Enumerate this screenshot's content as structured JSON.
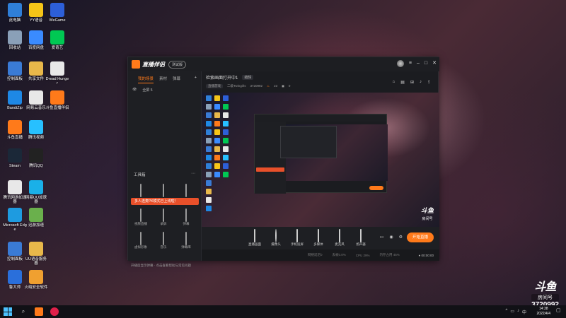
{
  "desktop": {
    "icons": [
      {
        "label": "此电脑",
        "icon": "computer-icon",
        "color": "#2f7fd8"
      },
      {
        "label": "YY语音",
        "icon": "yy-icon",
        "color": "#f5c518"
      },
      {
        "label": "WeGame",
        "icon": "wegame-icon",
        "color": "#2d5fd8"
      },
      {
        "label": "回收站",
        "icon": "recycle-bin-icon",
        "color": "#8aa0b8"
      },
      {
        "label": "百度网盘",
        "icon": "baidu-netdisk-icon",
        "color": "#3a8bff"
      },
      {
        "label": "爱奇艺",
        "icon": "iqiyi-icon",
        "color": "#00c853"
      },
      {
        "label": "控制面板",
        "icon": "control-panel-icon",
        "color": "#3a7bd5"
      },
      {
        "label": "共享文件",
        "icon": "folder-icon",
        "color": "#e8b84a"
      },
      {
        "label": "Dread Hunger",
        "icon": "file-icon",
        "color": "#e8e8e8"
      },
      {
        "label": "BandiZip",
        "icon": "bandizip-icon",
        "color": "#1e88e5"
      },
      {
        "label": "网易云音乐",
        "icon": "file-icon",
        "color": "#e8e8e8"
      },
      {
        "label": "斗鱼直播伴侣",
        "icon": "douyu-icon",
        "color": "#ff7a1a"
      },
      {
        "label": "斗鱼直播",
        "icon": "douyu-icon",
        "color": "#ff7a1a"
      },
      {
        "label": "腾讯视频",
        "icon": "tencent-video-icon",
        "color": "#27c0ff"
      },
      {
        "label": "Steam",
        "icon": "steam-icon",
        "color": "#1b2838"
      },
      {
        "label": "腾讯QQ",
        "icon": "qq-icon",
        "color": "#222"
      },
      {
        "label": "腾讯网游加速器",
        "icon": "file-icon",
        "color": "#e8e8e8"
      },
      {
        "label": "网易UU加速器",
        "icon": "uu-icon",
        "color": "#1ab0e8"
      },
      {
        "label": "Microsoft Edge",
        "icon": "edge-icon",
        "color": "#1e9be0"
      },
      {
        "label": "迅游加速",
        "icon": "xunyou-icon",
        "color": "#6ab04c"
      },
      {
        "label": "控制面板",
        "icon": "control-panel-icon",
        "color": "#3a7bd5"
      },
      {
        "label": "UU语音服务器",
        "icon": "folder-icon",
        "color": "#e8b84a"
      },
      {
        "label": "鲁大师",
        "icon": "ludashi-icon",
        "color": "#2a6fdb"
      },
      {
        "label": "火绒安全软件",
        "icon": "huorong-icon",
        "color": "#f0a030"
      }
    ]
  },
  "app": {
    "name": "直播伴侣",
    "version_badge": "测试版",
    "sidebar_tabs": [
      "我的场景",
      "素材",
      "弹幕"
    ],
    "scene_name": "全屏 5",
    "tools_title": "工具箱",
    "tools": [
      {
        "label": "截图"
      },
      {
        "label": "主播任务"
      },
      {
        "label": "礼物"
      },
      {
        "label": "视频直播"
      },
      {
        "label": "录屏"
      },
      {
        "label": "弹幕"
      },
      {
        "label": "虚拟形象"
      },
      {
        "label": "音乐"
      },
      {
        "label": "弹幕库"
      }
    ],
    "tip_text": "多人连麦PK模式已上线啦！",
    "sidebar_bottom": "开播后显示弹幕 ·  点击查看帮助与常见问题",
    "room_title": "检索画面打开中1",
    "edit_label": "编辑",
    "category": "直播游戏",
    "sub_info": [
      "二级Twingirls",
      "3720992",
      "23",
      "0"
    ],
    "bottom_tools": [
      {
        "label": "直播画面",
        "icon": "monitor-icon"
      },
      {
        "label": "摄像头",
        "icon": "camera-icon"
      },
      {
        "label": "手机投屏",
        "icon": "phone-icon"
      },
      {
        "label": "多媒体",
        "icon": "media-icon"
      },
      {
        "label": "麦克风",
        "icon": "mic-icon"
      },
      {
        "label": "扬声器",
        "icon": "speaker-icon"
      }
    ],
    "start_button": "开始直播",
    "status_items": [
      "网络延迟0",
      "丢帧0.0%",
      "CPU 29%",
      "内存占用 45%"
    ],
    "live_time": "00:00:00",
    "preview_watermark": "斗鱼",
    "preview_watermark_sub": "房间号"
  },
  "room_watermark": {
    "logo": "斗鱼",
    "label": "房间号",
    "number": "3720992"
  },
  "taskbar": {
    "time": "14:38",
    "date": "2022/4/4"
  }
}
